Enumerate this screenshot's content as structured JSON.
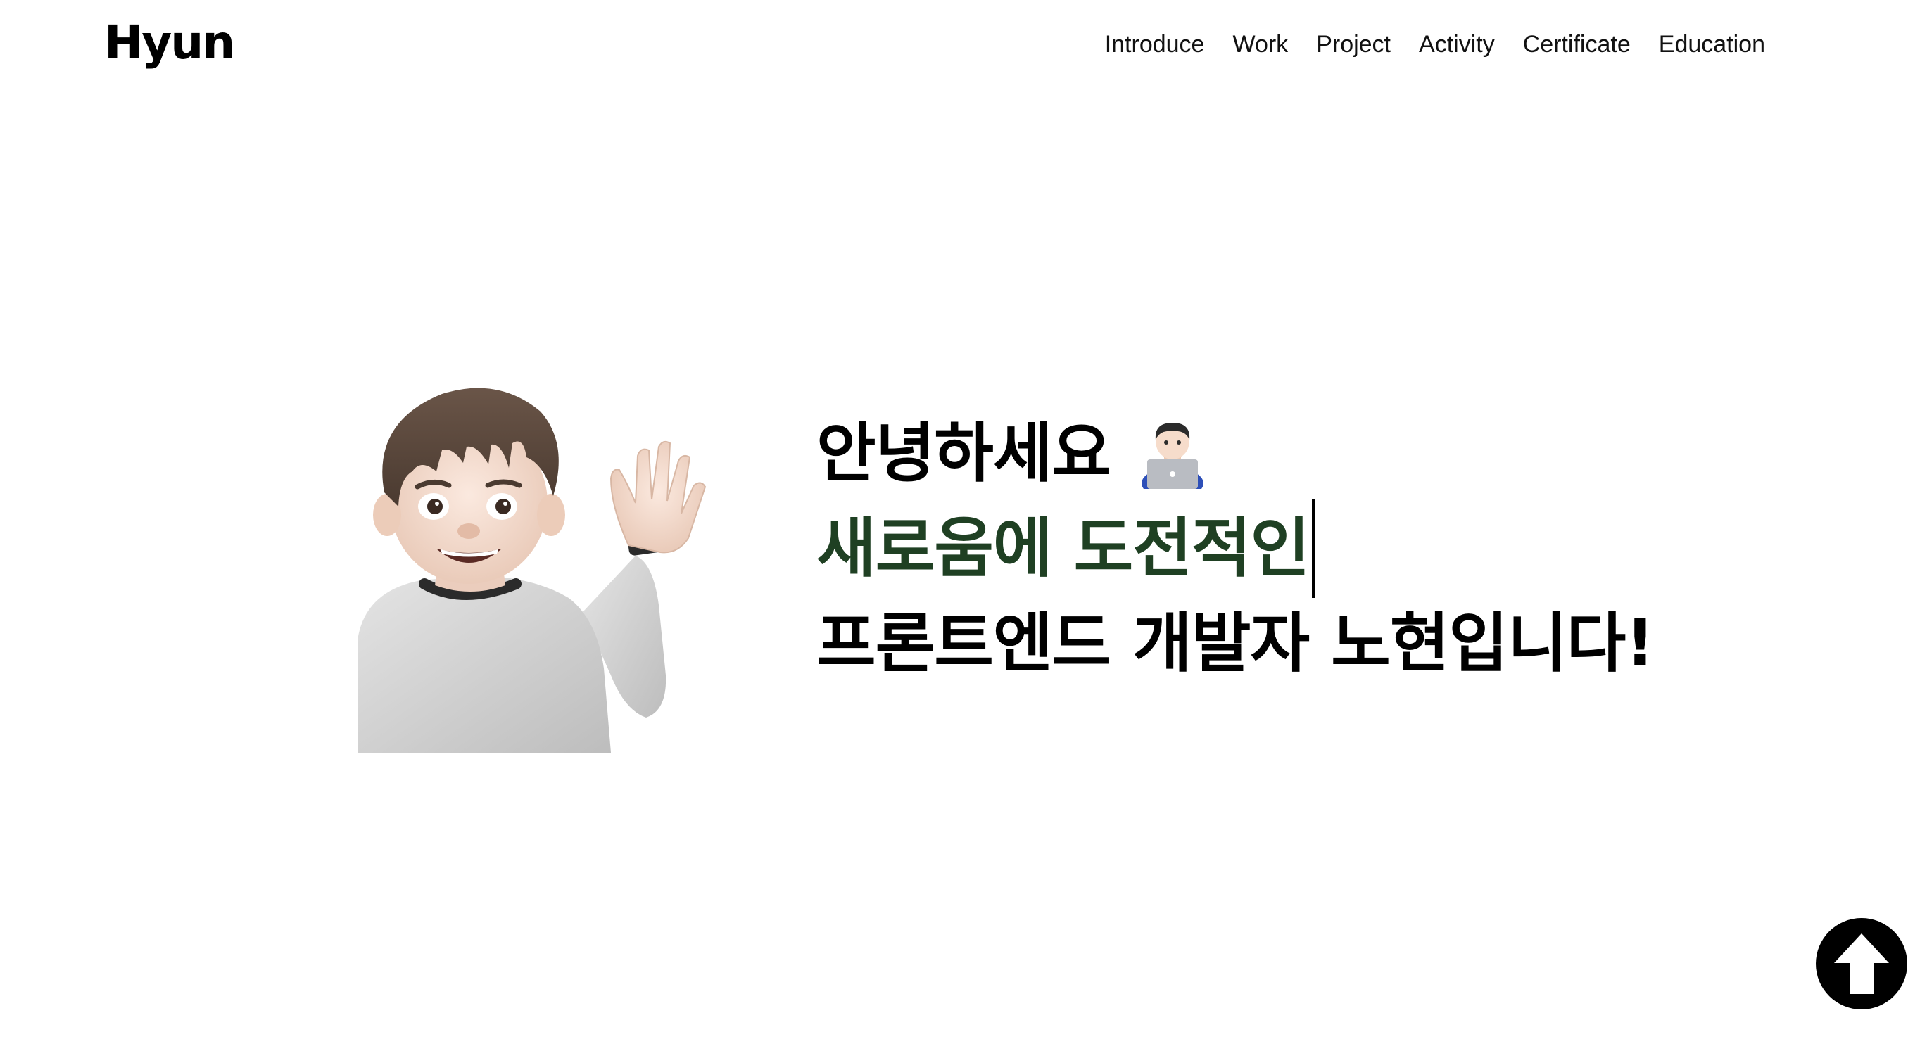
{
  "header": {
    "logo": "Hyun",
    "nav": [
      {
        "label": "Introduce"
      },
      {
        "label": "Work"
      },
      {
        "label": "Project"
      },
      {
        "label": "Activity"
      },
      {
        "label": "Certificate"
      },
      {
        "label": "Education"
      }
    ]
  },
  "hero": {
    "line1": "안녕하세요",
    "line2": "새로움에 도전적인",
    "line3": "프론트엔드 개발자 노현입니다!",
    "line1_icon": "man-technologist-icon",
    "avatar_icon": "waving-memoji-icon",
    "line2_color": "#1f4023"
  },
  "scroll_top": {
    "icon": "arrow-up-icon",
    "color": "#000000"
  }
}
